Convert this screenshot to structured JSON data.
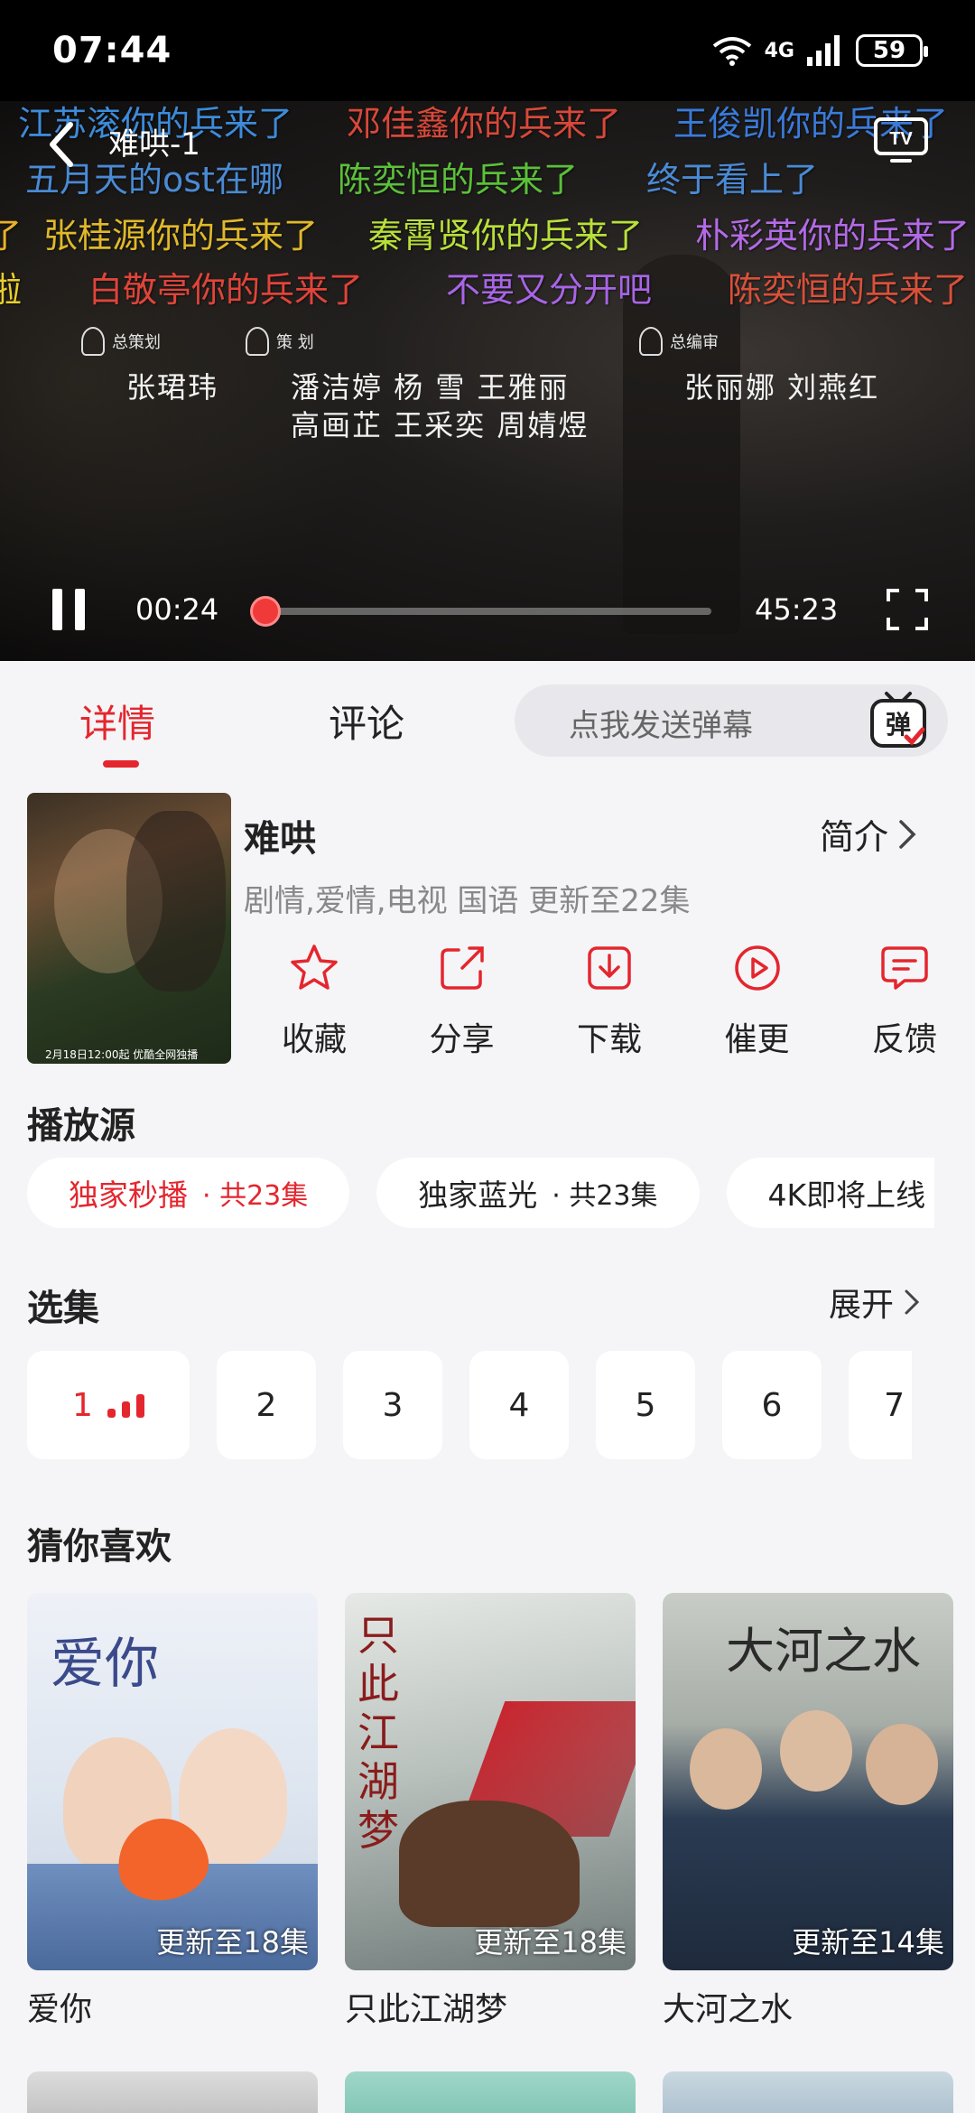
{
  "status_bar": {
    "time": "07:44",
    "network": "4G",
    "battery": "59"
  },
  "player": {
    "title": "难哄-1",
    "current_time": "00:24",
    "total_time": "45:23",
    "progress": 0.009,
    "danmaku": [
      {
        "text": "江苏滚你的兵来了",
        "color": "#3d8bd9"
      },
      {
        "text": "邓佳鑫你的兵来了",
        "color": "#d9483a"
      },
      {
        "text": "王俊凯你的兵来了",
        "color": "#3a7bd9"
      },
      {
        "text": "五月天的ost在哪",
        "color": "#4a8ad4"
      },
      {
        "text": "陈奕恒的兵来了",
        "color": "#5bbf3a"
      },
      {
        "text": "终于看上了",
        "color": "#4a8ad4"
      },
      {
        "text": "了",
        "color": "#e8b12a"
      },
      {
        "text": "张桂源你的兵来了",
        "color": "#e0b92a"
      },
      {
        "text": "秦霄贤你的兵来了",
        "color": "#b8e03a"
      },
      {
        "text": "朴彩英你的兵来了",
        "color": "#b36ae6"
      },
      {
        "text": "啦",
        "color": "#e8d02a"
      },
      {
        "text": "白敬亭你的兵来了",
        "color": "#e0443a"
      },
      {
        "text": "不要又分开吧",
        "color": "#a865e6"
      },
      {
        "text": "陈奕恒的兵来了",
        "color": "#d9503a"
      }
    ],
    "credits": {
      "producer_label": "总策划",
      "planner_label": "策 划",
      "editor_label": "总编审",
      "producer": "张珺玮",
      "planners_line1": "潘洁婷  杨 雪  王雅丽",
      "planners_line2": "高画芷  王采奕  周婧煜",
      "editors": "张丽娜   刘燕红"
    }
  },
  "tabs": {
    "details": "详情",
    "comments": "评论",
    "danmu_placeholder": "点我发送弹幕",
    "danmu_button": "弹"
  },
  "show": {
    "title": "难哄",
    "intro_label": "简介",
    "meta": "剧情,爱情,电视 国语 更新至22集",
    "poster_caption": "2月18日12:00起 优酷全网独播"
  },
  "actions": [
    {
      "label": "收藏",
      "icon": "star-icon"
    },
    {
      "label": "分享",
      "icon": "share-icon"
    },
    {
      "label": "下载",
      "icon": "download-icon"
    },
    {
      "label": "催更",
      "icon": "play-circle-icon"
    },
    {
      "label": "反馈",
      "icon": "feedback-icon"
    }
  ],
  "sources": {
    "title": "播放源",
    "items": [
      {
        "name": "独家秒播",
        "count": "· 共23集"
      },
      {
        "name": "独家蓝光",
        "count": "· 共23集"
      },
      {
        "name": "4K即将上线",
        "count": ""
      }
    ]
  },
  "episodes": {
    "title": "选集",
    "expand_label": "展开",
    "items": [
      "1",
      "2",
      "3",
      "4",
      "5",
      "6",
      "7"
    ]
  },
  "recommendations": {
    "title": "猜你喜欢",
    "items": [
      {
        "title": "爱你",
        "badge": "更新至18集",
        "poster_text": "爱你"
      },
      {
        "title": "只此江湖梦",
        "badge": "更新至18集",
        "poster_text": "只此江湖梦"
      },
      {
        "title": "大河之水",
        "badge": "更新至14集",
        "poster_text": "大河之水"
      }
    ]
  }
}
